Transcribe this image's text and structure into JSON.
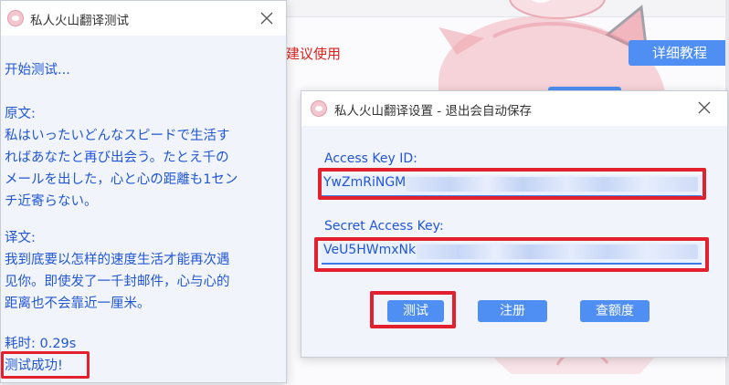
{
  "background": {
    "warning_text": "建议使用",
    "tutorial_button": "详细教程"
  },
  "test_window": {
    "title": "私人火山翻译测试",
    "lines": {
      "start": "开始测试...",
      "original_label": "原文:",
      "original_1": "私はいったいどんなスピードで生活す",
      "original_2": "ればあなたと再び出会う。たとえ千の",
      "original_3": "メールを出した，心と心の距離も1セン",
      "original_4": "チ近寄らない。",
      "translated_label": "译文:",
      "translated_1": "我到底要以怎样的速度生活才能再次遇",
      "translated_2": "见你。即使发了一千封邮件，心与心的",
      "translated_3": "距离也不会靠近一厘米。",
      "elapsed": "耗时: 0.29s",
      "result": "测试成功!"
    }
  },
  "settings_window": {
    "title": "私人火山翻译设置 - 退出会自动保存",
    "access_key_label": "Access Key ID:",
    "access_key_value": "YwZmRiNGM",
    "secret_key_label": "Secret Access Key:",
    "secret_key_value": "VeU5HWmxNk",
    "buttons": {
      "test": "测试",
      "register": "注册",
      "quota": "查额度"
    }
  },
  "colors": {
    "accent": "#4f8ff4",
    "text_blue": "#2156d6",
    "highlight_red": "#e2202e"
  }
}
